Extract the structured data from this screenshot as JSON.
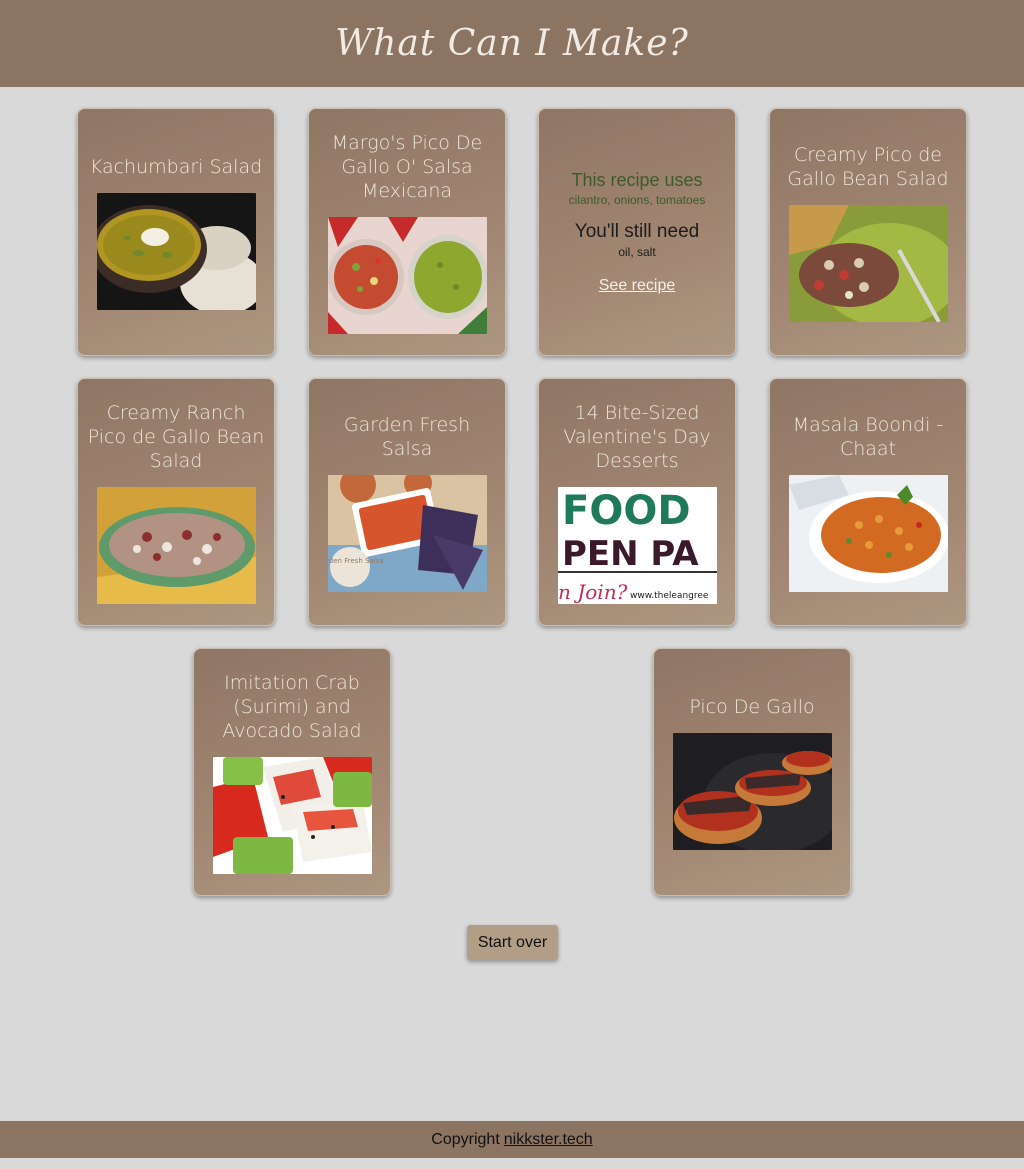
{
  "header": {
    "title": "What Can I Make?"
  },
  "recipes": [
    {
      "title": "Kachumbari Salad",
      "image_icon": "soup-bowl-photo"
    },
    {
      "title": "Margo's Pico De Gallo O' Salsa Mexicana",
      "image_icon": "salsa-bowls-photo"
    },
    {
      "flipped": true,
      "uses_label": "This recipe uses",
      "uses_list": "cilantro, onions, tomatoes",
      "need_label": "You'll still need",
      "need_list": "oil, salt",
      "link_label": "See recipe"
    },
    {
      "title": "Creamy Pico de Gallo Bean Salad",
      "image_icon": "bean-salad-photo"
    },
    {
      "title": "Creamy Ranch Pico de Gallo Bean Salad",
      "image_icon": "bean-plate-photo"
    },
    {
      "title": "Garden Fresh Salsa",
      "image_icon": "salsa-chips-photo",
      "image_caption": "Garden Fresh Salsa"
    },
    {
      "title": "14 Bite-Sized Valentine's Day Desserts",
      "image_icon": "food-pen-pals-banner",
      "banner_line1": "FOOD",
      "banner_line2": "PEN PA",
      "banner_line3": "n Join?",
      "banner_url": "www.theleangree"
    },
    {
      "title": "Masala Boondi - Chaat",
      "image_icon": "chaat-plate-photo"
    },
    {
      "title": "Imitation Crab (Surimi) and Avocado Salad",
      "image_icon": "crab-avocado-photo"
    },
    {
      "title": "Pico De Gallo",
      "image_icon": "bruschetta-photo"
    }
  ],
  "start_over_label": "Start over",
  "footer": {
    "copyright_label": "Copyright",
    "link_label": "nikkster.tech"
  },
  "colors": {
    "header_bg": "#8c7463",
    "page_bg": "#d9d9d9",
    "card_bg": "#9c826f",
    "button_bg": "#b29e86"
  }
}
